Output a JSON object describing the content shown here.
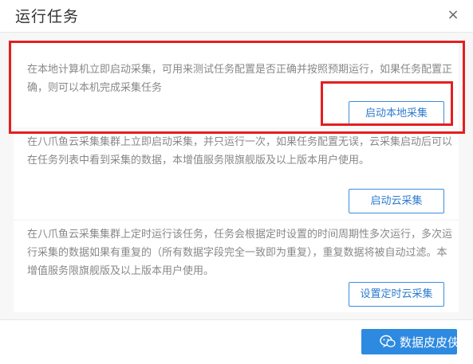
{
  "dialog": {
    "title": "运行任务",
    "close_glyph": "×",
    "options": [
      {
        "description": "在本地计算机立即启动采集，可用来测试任务配置是否正确并按照预期运行，如果任务配置正确，则可以本机完成采集任务",
        "button_label": "启动本地采集",
        "highlighted": true
      },
      {
        "description": "在八爪鱼云采集集群上立即启动采集，并只运行一次，如果任务配置无误，云采集启动后可以在任务列表中看到采集的数据，本增值服务限旗舰版及以上版本用户使用。",
        "button_label": "启动云采集",
        "highlighted": false
      },
      {
        "description": "在八爪鱼云采集集群上定时运行该任务，任务会根据定时设置的时间周期性多次运行，多次运行采集的数据如果有重复的（所有数据字段完全一致即为重复），重复数据将被自动过滤。本增值服务限旗舰版及以上版本用户使用。",
        "button_label": "设置定时云采集",
        "highlighted": false
      }
    ]
  },
  "watermark": {
    "text": "数据皮皮侠",
    "icon": "wechat-icon"
  },
  "colors": {
    "accent": "#2d8ae0",
    "highlight": "#e41f1f",
    "text_muted": "#888888"
  }
}
